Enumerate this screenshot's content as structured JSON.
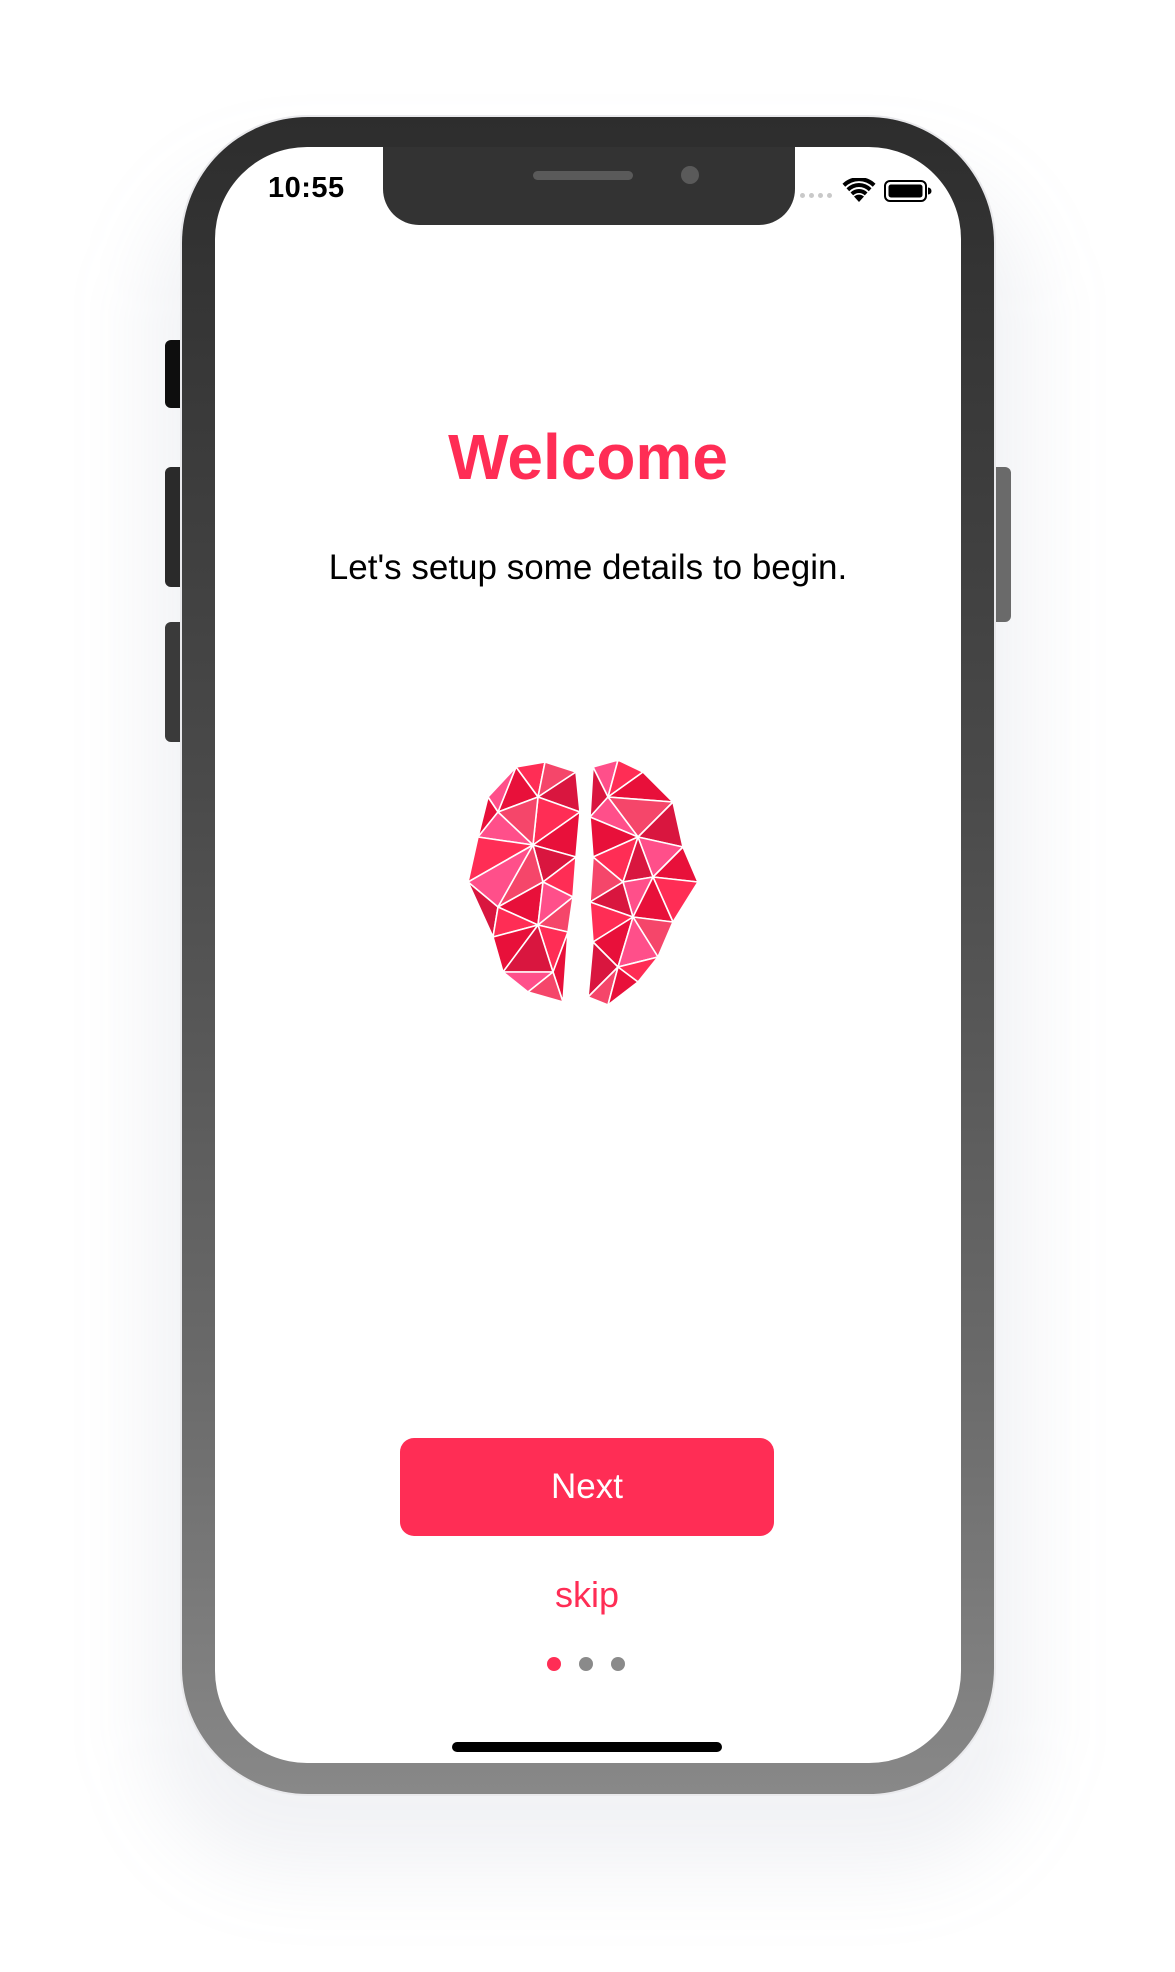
{
  "status_bar": {
    "time": "10:55"
  },
  "onboarding": {
    "title": "Welcome",
    "subtitle": "Let's setup some details to begin.",
    "illustration": "brain-icon",
    "next_label": "Next",
    "skip_label": "skip",
    "page_count": 3,
    "current_page": 1
  },
  "colors": {
    "accent": "#ff2d55",
    "page_dot_inactive": "#8a8a8a",
    "brain_shades": [
      "#ff2d55",
      "#e8103a",
      "#ff4f8a",
      "#f5466a",
      "#d9163f"
    ]
  }
}
